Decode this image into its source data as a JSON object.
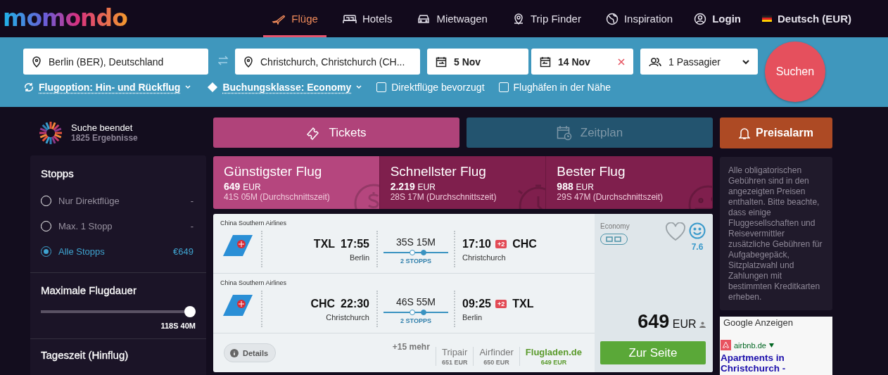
{
  "logo": "momondo",
  "nav": [
    {
      "label": "Flüge",
      "selected": true
    },
    {
      "label": "Hotels",
      "selected": false
    },
    {
      "label": "Mietwagen",
      "selected": false
    },
    {
      "label": "Trip Finder",
      "selected": false
    },
    {
      "label": "Inspiration",
      "selected": false
    }
  ],
  "login": "Login",
  "language": "Deutsch (EUR)",
  "search": {
    "origin": "Berlin (BER), Deutschland",
    "destination": "Christchurch, Christchurch (CH...",
    "depart": "5 Nov",
    "return": "14 Nov",
    "passengers": "1 Passagier",
    "button": "Suchen"
  },
  "options": [
    {
      "kind": "dropdown",
      "label": "Flugoption: Hin- und Rückflug"
    },
    {
      "kind": "dropdown",
      "label": "Buchungsklasse: Economy"
    },
    {
      "kind": "checkbox",
      "label": "Direktflüge bevorzugt",
      "checked": false
    },
    {
      "kind": "checkbox",
      "label": "Flughäfen in der Nähe",
      "checked": false
    }
  ],
  "status": {
    "title": "Suche beendet",
    "count": "1825 Ergebnisse"
  },
  "filters": {
    "stops": {
      "title": "Stopps",
      "options": [
        {
          "label": "Nur Direktflüge",
          "price": "-",
          "selected": false
        },
        {
          "label": "Max. 1 Stopp",
          "price": "-",
          "selected": false
        },
        {
          "label": "Alle Stopps",
          "price": "€649",
          "selected": true
        }
      ]
    },
    "duration": {
      "title": "Maximale Flugdauer",
      "level": 1,
      "reading": "118S 40M"
    },
    "daytime": {
      "title": "Tageszeit (Hinflug)"
    }
  },
  "view_tabs": [
    {
      "label": "Tickets",
      "selected": true
    },
    {
      "label": "Zeitplan",
      "selected": false
    }
  ],
  "sort_tabs": [
    {
      "kind": "cheapest",
      "title": "Günstigster Flug",
      "price": "649",
      "currency": "EUR",
      "duration": "41S 05M (Durchschnittszeit)",
      "selected": true
    },
    {
      "kind": "fastest",
      "title": "Schnellster Flug",
      "price": "2.219",
      "currency": "EUR",
      "duration": "28S 17M (Durchschnittszeit)",
      "selected": false
    },
    {
      "kind": "best",
      "title": "Bester Flug",
      "price": "988",
      "currency": "EUR",
      "duration": "29S 47M (Durchschnittszeit)",
      "selected": false
    }
  ],
  "result": {
    "legs": [
      {
        "airline": "China Southern Airlines",
        "from_code": "TXL",
        "dep_time": "17:55",
        "from_city": "Berlin",
        "duration": "35S 15M",
        "stops": "2 STOPPS",
        "arr_time": "17:10",
        "day_offset": "+2",
        "to_code": "CHC",
        "to_city": "Christchurch"
      },
      {
        "airline": "China Southern Airlines",
        "from_code": "CHC",
        "dep_time": "22:30",
        "from_city": "Christchurch",
        "duration": "46S 55M",
        "stops": "2 STOPPS",
        "arr_time": "09:25",
        "day_offset": "+2",
        "to_code": "TXL",
        "to_city": "Berlin"
      }
    ],
    "details": "Details",
    "more": "+15 mehr",
    "providers": [
      {
        "name": "Tripair",
        "price": "651 EUR",
        "cheapest": false
      },
      {
        "name": "Airfinder",
        "price": "650 EUR",
        "cheapest": false
      },
      {
        "name": "Flugladen.de",
        "price": "649 EUR",
        "cheapest": true
      }
    ],
    "cabin": "Economy",
    "favorite": false,
    "rating": "7.6",
    "price": "649",
    "currency": "EUR",
    "button": "Zur Seite"
  },
  "alert_button": "Preisalarm",
  "notice": "Alle obligatorischen Gebühren sind in den angezeigten Preisen enthalten. Bitte beachte, dass einige Fluggesellschaften und Reisevermittler zusätzliche Gebühren für Aufgabegepäck, Sitzplatzwahl und Zahlungen mit bestimmten Kreditkarten erheben.",
  "ads": {
    "title": "Google Anzeigen",
    "domain": "airbnb.de",
    "headline": "Apartments in Christchurch -"
  }
}
